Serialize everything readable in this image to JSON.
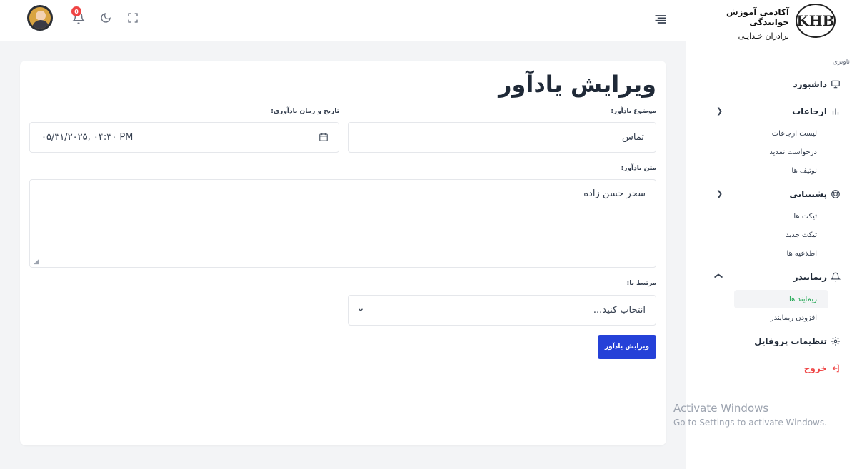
{
  "header": {
    "notification_count": "0"
  },
  "sidebar": {
    "brand_title": "آکادمی آموزش خوانندگی",
    "brand_subtitle": "برادران خـدایـی",
    "logo_text": "KHB",
    "nav_label": "ناوبری",
    "items": [
      {
        "label": "داشبورد"
      },
      {
        "label": "ارجاعات",
        "children": [
          "لیست ارجاعات",
          "درخواست تمدید",
          "نوتیف ها"
        ]
      },
      {
        "label": "پشتیبانی",
        "children": [
          "تیکت ها",
          "تیکت جدید",
          "اطلاعیه ها"
        ]
      },
      {
        "label": "ریمایندر",
        "children": [
          "ریمایند ها",
          "افزودن ریمایندر"
        ]
      },
      {
        "label": "تنظیمات پروفایل"
      },
      {
        "label": "خروج"
      }
    ]
  },
  "main": {
    "title": "ویرایش یادآور",
    "subject_label": "موضوع یادآور:",
    "subject_value": "تماس",
    "datetime_label": "تاریخ و زمان یادآوری:",
    "datetime_value": "۰۵/۳۱/۲۰۲۵, ۰۴:۳۰ PM",
    "body_label": "متن یادآور:",
    "body_value": "سحر حسن زاده",
    "related_label": "مرتبط با:",
    "related_placeholder": "انتخاب کنید...",
    "submit_label": "ویرایش یادآور"
  },
  "watermark": {
    "line1": "Activate Windows",
    "line2": "Go to Settings to activate Windows."
  }
}
